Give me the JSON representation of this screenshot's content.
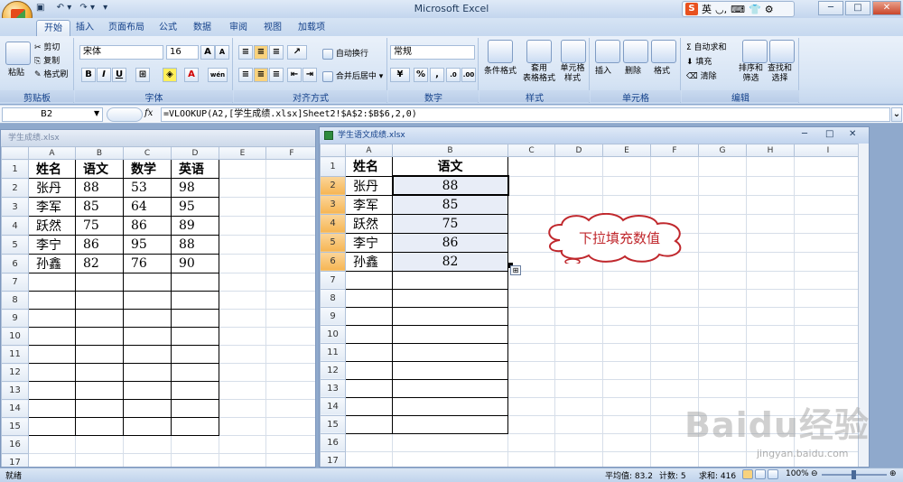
{
  "app": {
    "title": "Microsoft Excel",
    "ime": {
      "logo": "S",
      "mode": "英"
    }
  },
  "tabs": [
    "开始",
    "插入",
    "页面布局",
    "公式",
    "数据",
    "审阅",
    "视图",
    "加载项"
  ],
  "ribbon": {
    "clipboard": {
      "paste": "粘贴",
      "cut": "剪切",
      "copy": "复制",
      "format_painter": "格式刷",
      "label": "剪贴板"
    },
    "font": {
      "name": "宋体",
      "size": "16",
      "bold": "B",
      "italic": "I",
      "underline": "U",
      "grow": "A",
      "shrink": "A",
      "color": "A",
      "phonetic": "wén",
      "label": "字体"
    },
    "alignment": {
      "wrap": "自动换行",
      "merge": "合并后居中",
      "label": "对齐方式"
    },
    "number": {
      "format": "常规",
      "percent": "%",
      "comma": ",",
      "label": "数字"
    },
    "styles": {
      "conditional": "条件格式",
      "table": "套用\n表格格式",
      "cell": "单元格\n样式",
      "label": "样式"
    },
    "cells": {
      "insert": "插入",
      "delete": "删除",
      "format": "格式",
      "label": "单元格"
    },
    "editing": {
      "autosum": "Σ 自动求和",
      "fill": "填充",
      "clear": "清除",
      "sort": "排序和\n筛选",
      "find": "查找和\n选择",
      "label": "编辑"
    }
  },
  "formula_bar": {
    "name_box": "B2",
    "fx": "fx",
    "formula": "=VLOOKUP(A2,[学生成绩.xlsx]Sheet2!$A$2:$B$6,2,0)"
  },
  "left_window": {
    "title": "学生成绩.xlsx",
    "columns": [
      "A",
      "B",
      "C",
      "D",
      "E",
      "F"
    ],
    "rows": [
      "1",
      "2",
      "3",
      "4",
      "5",
      "6",
      "7",
      "8",
      "9",
      "10",
      "11",
      "12",
      "13",
      "14",
      "15",
      "16",
      "17"
    ],
    "cells": [
      [
        "姓名",
        "语文",
        "数学",
        "英语"
      ],
      [
        "张丹",
        "88",
        "53",
        "98"
      ],
      [
        "李军",
        "85",
        "64",
        "95"
      ],
      [
        "跃然",
        "75",
        "86",
        "89"
      ],
      [
        "李宁",
        "86",
        "95",
        "88"
      ],
      [
        "孙鑫",
        "82",
        "76",
        "90"
      ]
    ]
  },
  "right_window": {
    "title": "学生语文成绩.xlsx",
    "columns": [
      "A",
      "B",
      "C",
      "D",
      "E",
      "F",
      "G",
      "H",
      "I"
    ],
    "rows": [
      "1",
      "2",
      "3",
      "4",
      "5",
      "6",
      "7",
      "8",
      "9",
      "10",
      "11",
      "12",
      "13",
      "14",
      "15",
      "16",
      "17"
    ],
    "cells": [
      [
        "姓名",
        "语文"
      ],
      [
        "张丹",
        "88"
      ],
      [
        "李军",
        "85"
      ],
      [
        "跃然",
        "75"
      ],
      [
        "李宁",
        "86"
      ],
      [
        "孙鑫",
        "82"
      ]
    ],
    "callout": "下拉填充数值"
  },
  "status": {
    "ready": "就绪",
    "average": "平均值: 83.2",
    "count": "计数: 5",
    "sum": "求和: 416",
    "zoom": "100%"
  },
  "watermark": {
    "brand": "Baidu经验",
    "url": "jingyan.baidu.com"
  },
  "colors": {
    "accent": "#15428b",
    "selection": "#e8edf7",
    "header_selected": "#f6b553",
    "callout": "#c0282d"
  }
}
